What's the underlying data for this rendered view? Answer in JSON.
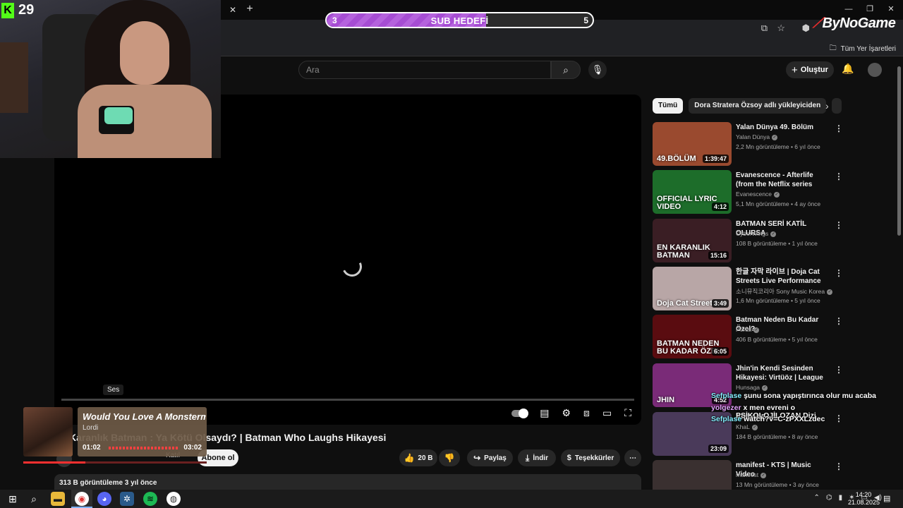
{
  "browser": {
    "bookmarks_all_label": "Tüm Yer İşaretleri"
  },
  "overlay": {
    "sub_goal": {
      "label": "SUB HEDEFİ",
      "current": "3",
      "target": "5",
      "progress": 0.6
    },
    "viewer_count": "29",
    "logo_text": "ByNoGame"
  },
  "youtube": {
    "search_placeholder": "Ara",
    "create_label": "Oluştur",
    "video": {
      "title": "Karanlık Batman : Ya Kötü Olsaydı? | Batman Who Laughs Hikayesi",
      "tooltip": "Ses",
      "join_label": "Katıl",
      "subscribe_label": "Abone ol",
      "likes": "20 B",
      "share_label": "Paylaş",
      "download_label": "İndir",
      "thanks_label": "Teşekkürler",
      "views_age": "313 B görüntüleme  3 yıl önce"
    },
    "chips": [
      "Tümü",
      "Dora Stratera Özsoy adlı yükleyiciden"
    ],
    "recommendations": [
      {
        "title": "Yalan Dünya 49. Bölüm",
        "channel": "Yalan Dünya",
        "meta": "2,2 Mn görüntüleme • 6 yıl önce",
        "duration": "1:39:47",
        "thumb_text": "49.BÖLÜM",
        "thumb_color": "#9a4a2f"
      },
      {
        "title": "Evanescence - Afterlife (from the Netflix series \"Devil May ...",
        "channel": "Evanescence",
        "meta": "5,1 Mn görüntüleme • 4 ay önce",
        "duration": "4:12",
        "thumb_text": "OFFICIAL LYRIC VIDEO",
        "thumb_color": "#1d6d2a"
      },
      {
        "title": "BATMAN SERİ KATİL OLURSA",
        "channel": "CyberWings",
        "meta": "108 B görüntüleme • 1 yıl önce",
        "duration": "15:16",
        "thumb_text": "EN KARANLIK BATMAN",
        "thumb_color": "#3a1e24"
      },
      {
        "title": "한글 자막 라이브 | Doja Cat Streets Live Performance  Vev...",
        "channel": "소니뮤직코리아 Sony Music Korea",
        "meta": "1,6 Mn görüntüleme • 5 yıl önce",
        "duration": "3:49",
        "thumb_text": "Doja Cat Streets",
        "thumb_color": "#b8a6a6"
      },
      {
        "title": "Batman Neden Bu Kadar Özel?",
        "channel": "Portal",
        "meta": "406 B görüntüleme • 5 yıl önce",
        "duration": "6:05",
        "thumb_text": "BATMAN NEDEN BU KADAR ÖZEL",
        "thumb_color": "#5a0c10"
      },
      {
        "title": "Jhin'in Kendi Sesinden Hikayesi: Virtüöz | League of Legends (4...",
        "channel": "Hunsaga",
        "meta": "",
        "duration": "4:52",
        "thumb_text": "JHIN",
        "thumb_color": "#7a2b78"
      },
      {
        "title": "ARCANE",
        "channel": "KhaL",
        "meta": "184 B görüntüleme • 8 ay önce",
        "duration": "23:09",
        "thumb_text": "",
        "thumb_color": "#4a3a5a"
      },
      {
        "title": "manifest - KTS | Music Video",
        "channel": "manifest",
        "meta": "13 Mn görüntüleme • 3 ay önce",
        "duration": "",
        "thumb_text": "",
        "thumb_color": "#3a3030"
      }
    ]
  },
  "chat": [
    {
      "user": "Sefplase",
      "message": "şunu sona yapıştırınca olur mu acaba"
    },
    {
      "user": "yolgezer",
      "message": "x men evreni o"
    },
    {
      "user": "",
      "message": "PSİKOLOJİLOZAN Dizi"
    },
    {
      "user": "Sefplase",
      "message": "watch?v=C-zPXXLzdec"
    }
  ],
  "spotify": {
    "title": "Would You Love A Monstermo",
    "artist": "Lordi",
    "current_time": "01:02",
    "duration": "03:02",
    "progress": 0.34
  },
  "taskbar": {
    "time": "14:20",
    "date": "21.08.2025"
  }
}
